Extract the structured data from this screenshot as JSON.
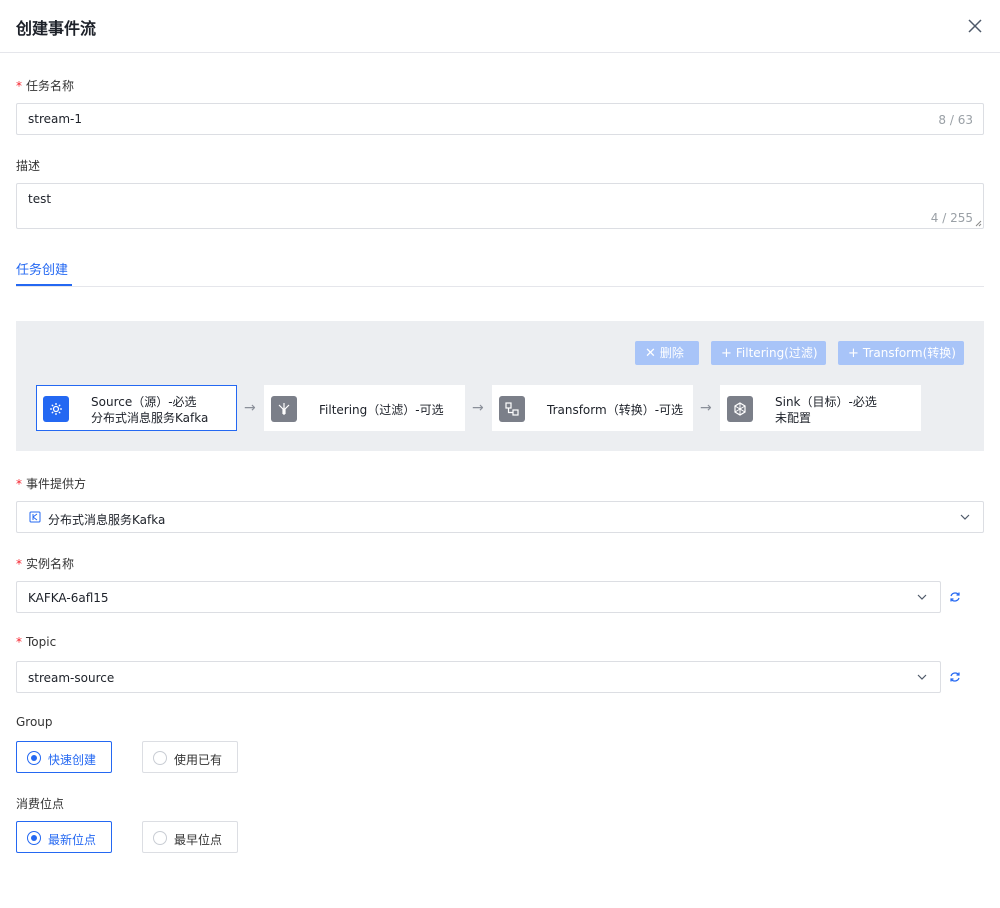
{
  "header": {
    "title": "创建事件流"
  },
  "colors": {
    "accent": "#2468f2",
    "required": "#f5222d",
    "disabled_button": "#a8c4f8"
  },
  "form": {
    "task_name": {
      "label": "任务名称",
      "value": "stream-1",
      "counter": "8 / 63"
    },
    "description": {
      "label": "描述",
      "value": "test",
      "counter": "4 / 255"
    }
  },
  "tabs": [
    {
      "label": "任务创建",
      "active": true
    }
  ],
  "flow": {
    "buttons": {
      "delete": "删除",
      "add_filtering": "Filtering(过滤)",
      "add_transform": "Transform(转换)"
    },
    "nodes": [
      {
        "title": "Source（源）-必选",
        "subtitle": "分布式消息服务Kafka",
        "icon": "source-gear-icon",
        "active": true
      },
      {
        "title": "Filtering（过滤）-可选",
        "subtitle": "",
        "icon": "filter-icon",
        "active": false
      },
      {
        "title": "Transform（转换）-可选",
        "subtitle": "",
        "icon": "transform-icon",
        "active": false
      },
      {
        "title": "Sink（目标）-必选",
        "subtitle": "未配置",
        "icon": "sink-icon",
        "active": false
      }
    ]
  },
  "source": {
    "provider": {
      "label": "事件提供方",
      "value": "分布式消息服务Kafka"
    },
    "instance": {
      "label": "实例名称",
      "value": "KAFKA-6afl15"
    },
    "topic": {
      "label": "Topic",
      "value": "stream-source"
    },
    "group": {
      "label": "Group",
      "options": [
        "快速创建",
        "使用已有"
      ],
      "selected": 0
    },
    "offset": {
      "label": "消费位点",
      "options": [
        "最新位点",
        "最早位点"
      ],
      "selected": 0
    }
  }
}
